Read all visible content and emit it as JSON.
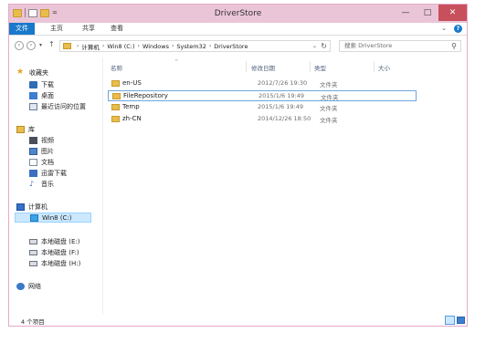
{
  "window": {
    "title": "DriverStore",
    "qat_arrow": "=",
    "buttons": {
      "minimize": "—",
      "maximize": "□",
      "close": "✕"
    }
  },
  "ribbon": {
    "tabs": [
      "文件",
      "主页",
      "共享",
      "查看"
    ],
    "expand": "⌄",
    "help": "?"
  },
  "nav": {
    "back": "‹",
    "forward": "›",
    "recent": "▾",
    "up": "↑"
  },
  "address": {
    "crumbs": [
      "计算机",
      "Win8 (C:)",
      "Windows",
      "System32",
      "DriverStore"
    ],
    "separator": "›",
    "dropdown": "⌄",
    "refresh": "↻"
  },
  "search": {
    "placeholder": "搜索 DriverStore",
    "icon": "search-icon"
  },
  "navpane": {
    "favorites": {
      "label": "收藏夹",
      "items": [
        "下载",
        "桌面",
        "最近访问的位置"
      ]
    },
    "libraries": {
      "label": "库",
      "items": [
        "视频",
        "图片",
        "文档",
        "迅雷下载",
        "音乐"
      ]
    },
    "computer": {
      "label": "计算机",
      "selected": "Win8 (C:)"
    },
    "drives": [
      "本地磁盘 (E:)",
      "本地磁盘 (F:)",
      "本地磁盘 (H:)"
    ],
    "network": {
      "label": "网络"
    }
  },
  "columns": {
    "name": "名称",
    "date": "修改日期",
    "type": "类型",
    "size": "大小",
    "sort_indicator": "^"
  },
  "files": [
    {
      "name": "en-US",
      "date": "2012/7/26 19:30",
      "type": "文件夹"
    },
    {
      "name": "FileRepository",
      "date": "2015/1/6 19:49",
      "type": "文件夹",
      "selected": true
    },
    {
      "name": "Temp",
      "date": "2015/1/6 19:49",
      "type": "文件夹"
    },
    {
      "name": "zh-CN",
      "date": "2014/12/26 18:50",
      "type": "文件夹"
    }
  ],
  "status": {
    "text": "4 个项目"
  },
  "colors": {
    "titlebar": "#eac5d8",
    "close": "#c7505c",
    "file_tab": "#1979ca",
    "selection": "#cce8ff",
    "folder": "#e9bd4c"
  }
}
